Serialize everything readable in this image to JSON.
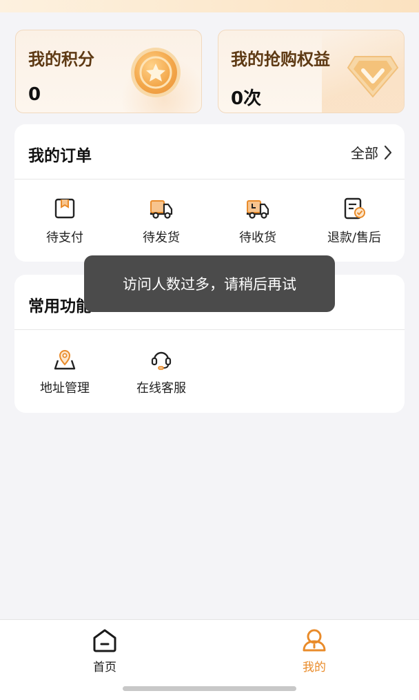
{
  "points_card": {
    "title": "我的积分",
    "value": "0"
  },
  "rights_card": {
    "title": "我的抢购权益",
    "value": "0次"
  },
  "orders": {
    "title": "我的订单",
    "view_all": "全部",
    "items": [
      {
        "label": "待支付",
        "icon": "pending-payment-icon"
      },
      {
        "label": "待发货",
        "icon": "truck-icon"
      },
      {
        "label": "待收货",
        "icon": "delivery-clock-icon"
      },
      {
        "label": "退款/售后",
        "icon": "refund-icon"
      }
    ]
  },
  "common": {
    "title": "常用功能",
    "items": [
      {
        "label": "地址管理",
        "icon": "location-pin-icon"
      },
      {
        "label": "在线客服",
        "icon": "headset-icon"
      }
    ]
  },
  "toast": {
    "message": "访问人数过多，请稍后再试"
  },
  "tabbar": {
    "items": [
      {
        "label": "首页",
        "icon": "home-icon",
        "active": false
      },
      {
        "label": "我的",
        "icon": "profile-icon",
        "active": true
      }
    ]
  },
  "colors": {
    "accent": "#e98b2a",
    "card_title": "#5e3a14",
    "toast_bg": "#4b4b4b",
    "page_bg": "#f4f4f7"
  }
}
